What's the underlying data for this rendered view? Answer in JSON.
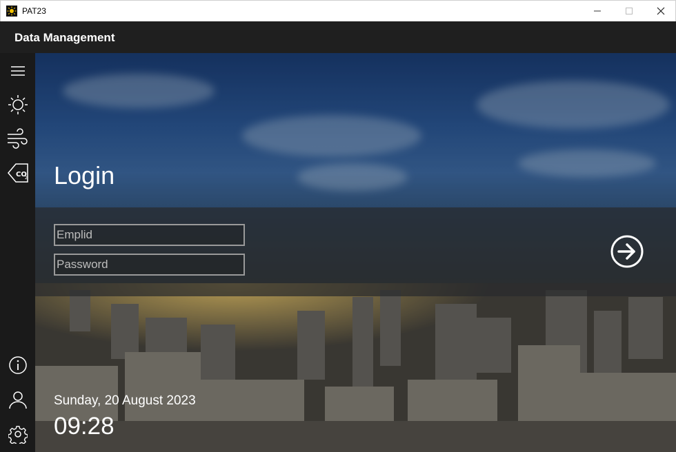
{
  "window": {
    "title": "PAT23"
  },
  "header": {
    "title": "Data Management"
  },
  "nav": {
    "top_icons": [
      "menu-icon",
      "sun-icon",
      "wind-icon",
      "co2-icon"
    ],
    "bottom_icons": [
      "info-icon",
      "user-icon",
      "settings-icon"
    ]
  },
  "login": {
    "title": "Login",
    "emplid_placeholder": "Emplid",
    "password_placeholder": "Password"
  },
  "footer": {
    "date": "Sunday, 20 August 2023",
    "time": "09:28"
  },
  "colors": {
    "header_bg": "#1f1f1f",
    "nav_bg": "#1a1a1a",
    "text": "#ffffff"
  }
}
